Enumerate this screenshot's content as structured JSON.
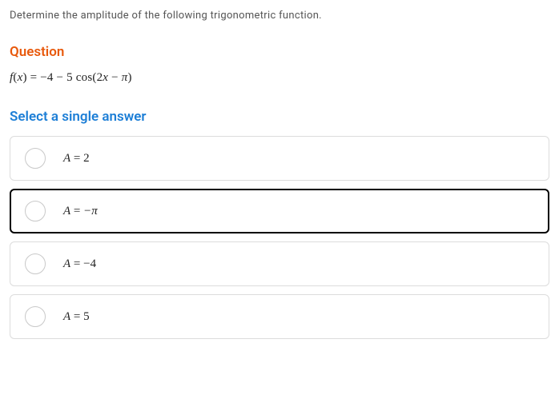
{
  "instruction": "Determine the amplitude of the following trigonometric function.",
  "question_heading": "Question",
  "formula": {
    "lhs_var": "f",
    "lhs_paren_open": "(",
    "lhs_arg": "x",
    "lhs_paren_close": ")",
    "eq": " = ",
    "rhs_a": "−4 − 5 ",
    "rhs_fn": "cos",
    "rhs_paren_open": "(",
    "rhs_inner_a": "2",
    "rhs_inner_var": "x",
    "rhs_inner_b": " − ",
    "rhs_inner_pi": "π",
    "rhs_paren_close": ")"
  },
  "select_heading": "Select a single answer",
  "options": [
    {
      "var": "A",
      "eq": " = ",
      "val": "2",
      "selected": false
    },
    {
      "var": "A",
      "eq": " = ",
      "val": "−π",
      "selected": true
    },
    {
      "var": "A",
      "eq": " = ",
      "val": "−4",
      "selected": false
    },
    {
      "var": "A",
      "eq": " = ",
      "val": "5",
      "selected": false
    }
  ]
}
